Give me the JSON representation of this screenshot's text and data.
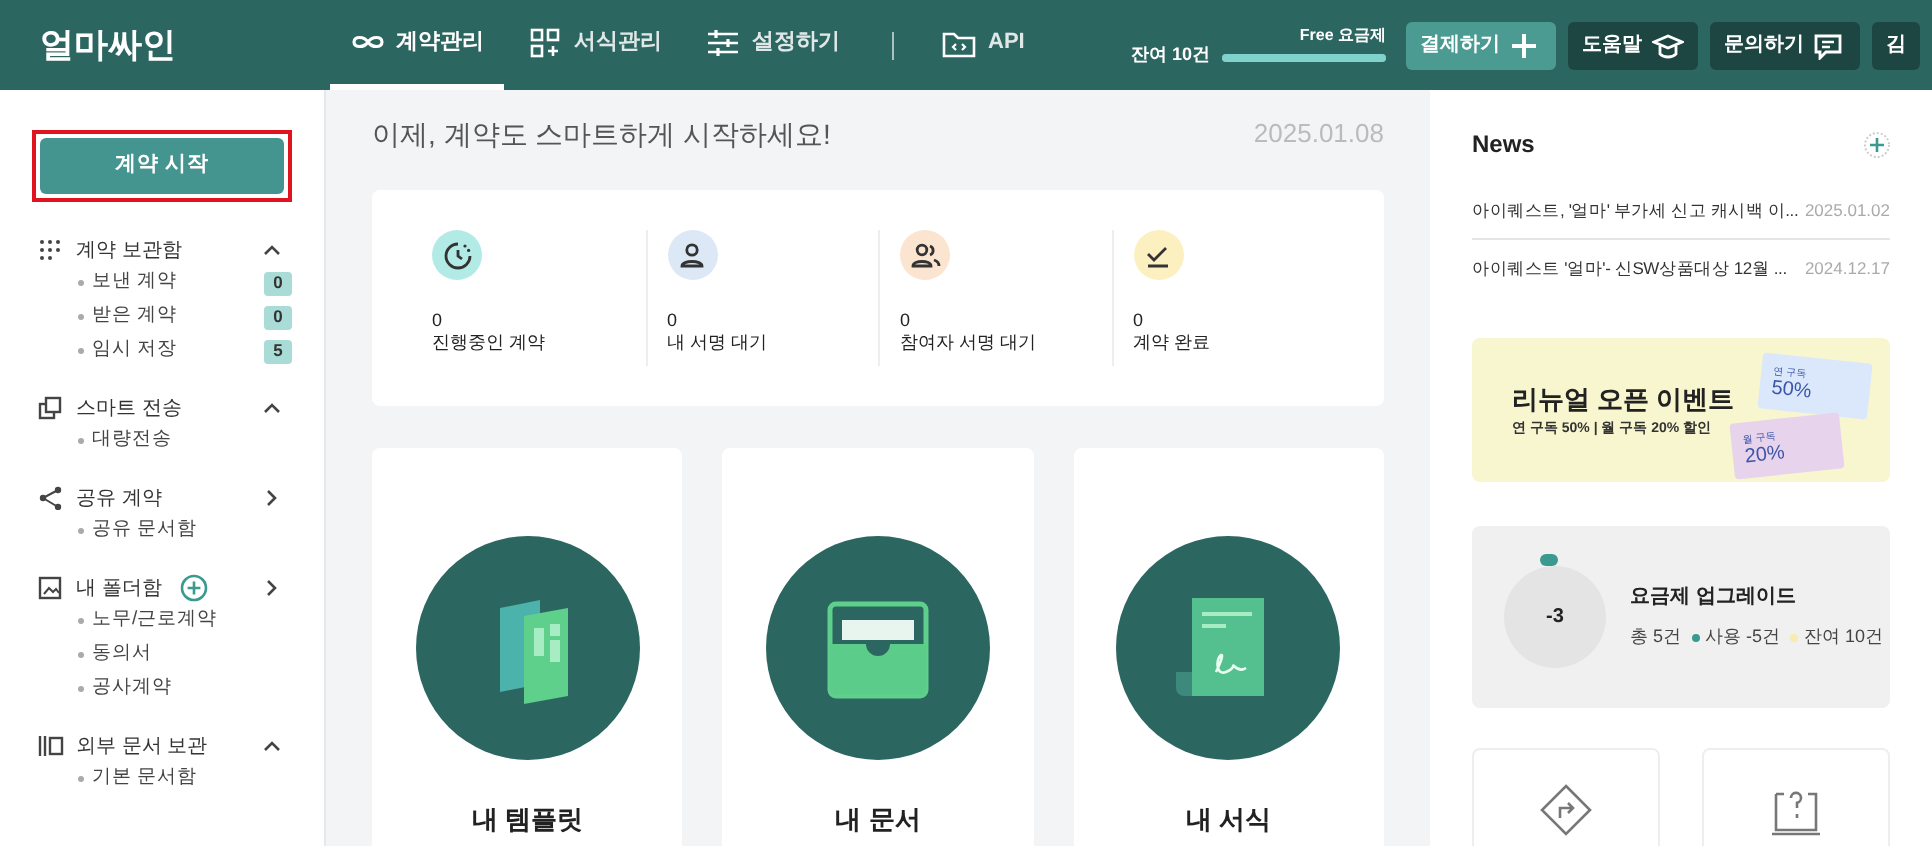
{
  "header": {
    "logo": "얼마싸인",
    "nav": [
      {
        "label": "계약관리",
        "kind": "infinity",
        "selected": true
      },
      {
        "label": "서식관리",
        "kind": "grid",
        "selected": false
      },
      {
        "label": "설정하기",
        "kind": "sliders",
        "selected": false
      },
      {
        "label": "API",
        "kind": "folder",
        "selected": false
      }
    ],
    "plan": {
      "name": "Free 요금제",
      "remaining": "잔여 10건",
      "level": 1
    },
    "buttons": [
      {
        "label": "결제하기",
        "kind": "plus"
      },
      {
        "label": "도움말",
        "kind": "cap"
      },
      {
        "label": "문의하기",
        "kind": "chat"
      },
      {
        "label": "김",
        "kind": "plain"
      }
    ]
  },
  "sidebar": {
    "start_button": {
      "label": "계약 시작",
      "highlighted": true
    },
    "sections": [
      {
        "label": "계약 보관함",
        "kind": "dots",
        "expanded": true,
        "add": false,
        "items": [
          {
            "label": "보낸 계약",
            "count": "0"
          },
          {
            "label": "받은 계약",
            "count": "0"
          },
          {
            "label": "임시 저장",
            "count": "5"
          }
        ]
      },
      {
        "label": "스마트 전송",
        "kind": "copy",
        "expanded": true,
        "add": false,
        "items": [
          {
            "label": "대량전송"
          }
        ]
      },
      {
        "label": "공유 계약",
        "kind": "share",
        "expanded": false,
        "add": false,
        "items": [
          {
            "label": "공유 문서함"
          }
        ]
      },
      {
        "label": "내 폴더함",
        "kind": "folder",
        "expanded": false,
        "add": true,
        "items": [
          {
            "label": "노무/근로계약"
          },
          {
            "label": "동의서"
          },
          {
            "label": "공사계약"
          }
        ]
      },
      {
        "label": "외부 문서 보관",
        "kind": "archive",
        "expanded": true,
        "add": false,
        "items": [
          {
            "label": "기본 문서함"
          }
        ]
      }
    ]
  },
  "main": {
    "headline": "이제, 계약도 스마트하게 시작하세요!",
    "date": "2025.01.08",
    "stats": [
      {
        "value": "0",
        "label": "진행중인 계약",
        "kind": "progress",
        "color": "#b2ebe6"
      },
      {
        "value": "0",
        "label": "내 서명 대기",
        "kind": "person",
        "color": "#dde8f6"
      },
      {
        "value": "0",
        "label": "참여자 서명 대기",
        "kind": "people",
        "color": "#fbe4d0"
      },
      {
        "value": "0",
        "label": "계약 완료",
        "kind": "done",
        "color": "#fcf0c0"
      }
    ],
    "cards": [
      {
        "label": "내 템플릿",
        "kind": "template"
      },
      {
        "label": "내 문서",
        "kind": "box"
      },
      {
        "label": "내 서식",
        "kind": "scroll"
      }
    ]
  },
  "right": {
    "news_title": "News",
    "news": [
      {
        "title": "아이퀘스트, '얼마' 부가세 신고 캐시백 이...",
        "date": "2025.01.02"
      },
      {
        "title": "아이퀘스트 '얼마'- 신SW상품대상 12월 ...",
        "date": "2024.12.17"
      }
    ],
    "banner": {
      "title": "리뉴얼 오픈 이벤트",
      "subtitle": "연 구독 50% | 월 구독 20% 할인",
      "coupons": [
        {
          "label": "연 구독",
          "value": "50%"
        },
        {
          "label": "월 구독",
          "value": "20%"
        }
      ]
    },
    "upgrade": {
      "value": "-3",
      "title": "요금제 업그레이드",
      "total": "총 5건",
      "legend": [
        {
          "label": "사용 -5건",
          "color": "#3a9a8f"
        },
        {
          "label": "잔여 10건",
          "color": "#f6ecae"
        }
      ]
    },
    "shortcuts": [
      {
        "kind": "sign"
      },
      {
        "kind": "manual"
      }
    ]
  }
}
